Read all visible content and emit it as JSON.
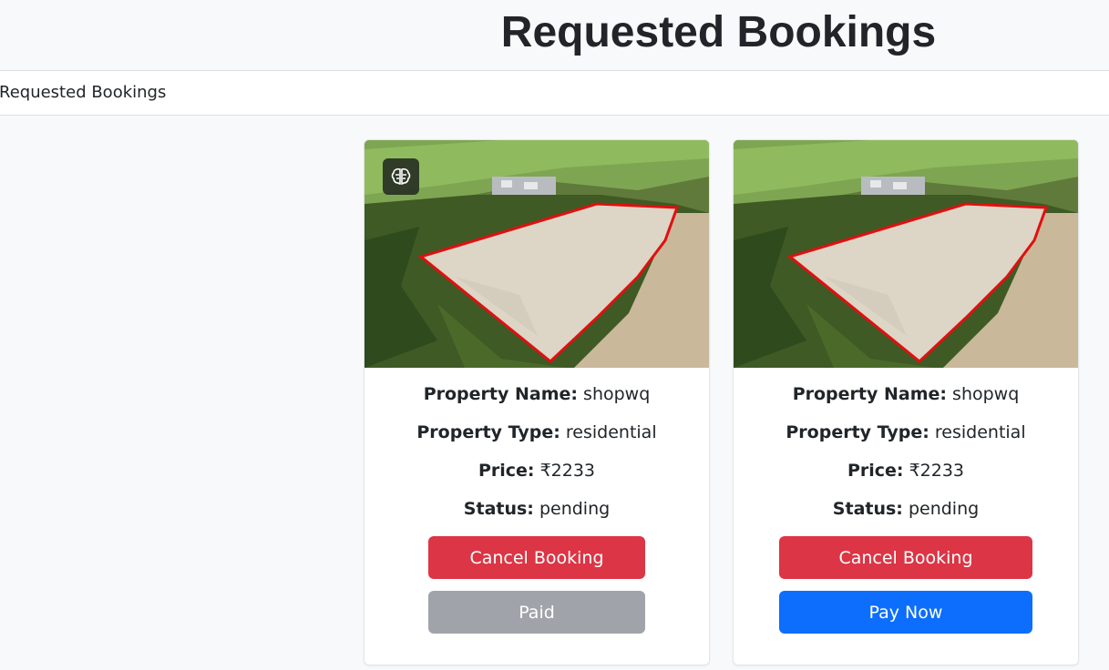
{
  "header": {
    "title": "Requested Bookings"
  },
  "nav": {
    "link": "Requested Bookings"
  },
  "labels": {
    "property_name": "Property Name:",
    "property_type": "Property Type:",
    "price": "Price:",
    "status": "Status:"
  },
  "bookings": [
    {
      "property_name": "shopwq",
      "property_type": "residential",
      "price": "₹2233",
      "status": "pending",
      "cancel_label": "Cancel Booking",
      "pay_label": "Paid",
      "badge_icon": "brain-icon",
      "pay_color": "#a0a4aa"
    },
    {
      "property_name": "shopwq",
      "property_type": "residential",
      "price": "₹2233",
      "status": "pending",
      "cancel_label": "Cancel Booking",
      "pay_label": "Pay Now",
      "pay_color": "#0d6efd"
    }
  ],
  "colors": {
    "danger": "#dc3545",
    "primary": "#0d6efd",
    "boundary": "#e01010"
  }
}
